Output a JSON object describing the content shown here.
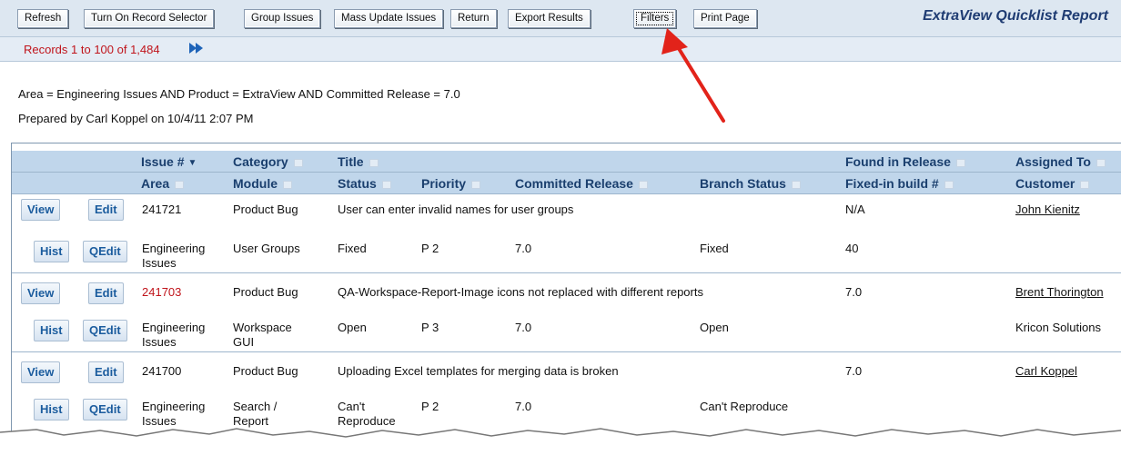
{
  "toolbar": {
    "buttons": [
      "Refresh",
      "Turn On Record Selector",
      "Group Issues",
      "Mass Update Issues",
      "Return",
      "Export Results",
      "Filters",
      "Print Page"
    ],
    "title": "ExtraView Quicklist Report"
  },
  "pager": {
    "records_text": "Records 1 to 100 of 1,484"
  },
  "filter_text": "Area = Engineering Issues AND Product = ExtraView AND Committed Release = 7.0",
  "prepared_text": "Prepared by Carl Koppel on 10/4/11 2:07 PM",
  "grid": {
    "header_row1": {
      "issue": "Issue #",
      "category": "Category",
      "title": "Title",
      "found": "Found in Release",
      "assigned": "Assigned To"
    },
    "header_row2": {
      "area": "Area",
      "module": "Module",
      "status": "Status",
      "priority": "Priority",
      "committed": "Committed Release",
      "branch": "Branch Status",
      "fixed_build": "Fixed-in build #",
      "customer": "Customer"
    },
    "button_labels": {
      "view": "View",
      "edit": "Edit",
      "hist": "Hist",
      "qedit": "QEdit"
    },
    "records": [
      {
        "issue": "241721",
        "category": "Product Bug",
        "title": "User can enter invalid names for user groups",
        "found": "N/A",
        "assigned": "John Kienitz",
        "area_l1": "Engineering",
        "area_l2": "Issues",
        "module_l1": "User Groups",
        "module_l2": "",
        "status_l1": "Fixed",
        "status_l2": "",
        "priority": "P 2",
        "committed": "7.0",
        "branch": "Fixed",
        "fixed_build": "40",
        "customer": ""
      },
      {
        "issue": "241703",
        "category": "Product Bug",
        "title": "QA-Workspace-Report-Image icons not replaced with different reports",
        "found": "7.0",
        "assigned": "Brent Thorington",
        "area_l1": "Engineering",
        "area_l2": "Issues",
        "module_l1": "Workspace",
        "module_l2": "GUI",
        "status_l1": "Open",
        "status_l2": "",
        "priority": "P 3",
        "committed": "7.0",
        "branch": "Open",
        "fixed_build": "",
        "customer": "Kricon Solutions"
      },
      {
        "issue": "241700",
        "category": "Product Bug",
        "title": "Uploading Excel templates for merging data is broken",
        "found": "7.0",
        "assigned": "Carl Koppel",
        "area_l1": "Engineering",
        "area_l2": "Issues",
        "module_l1": "Search /",
        "module_l2": "Report",
        "status_l1": "Can't",
        "status_l2": "Reproduce",
        "priority": "P 2",
        "committed": "7.0",
        "branch": "Can't Reproduce",
        "fixed_build": "",
        "customer": ""
      }
    ]
  },
  "colors": {
    "accent_red": "#c0141b",
    "header_blue": "#c0d6eb",
    "link_blue": "#1b5c9e"
  }
}
